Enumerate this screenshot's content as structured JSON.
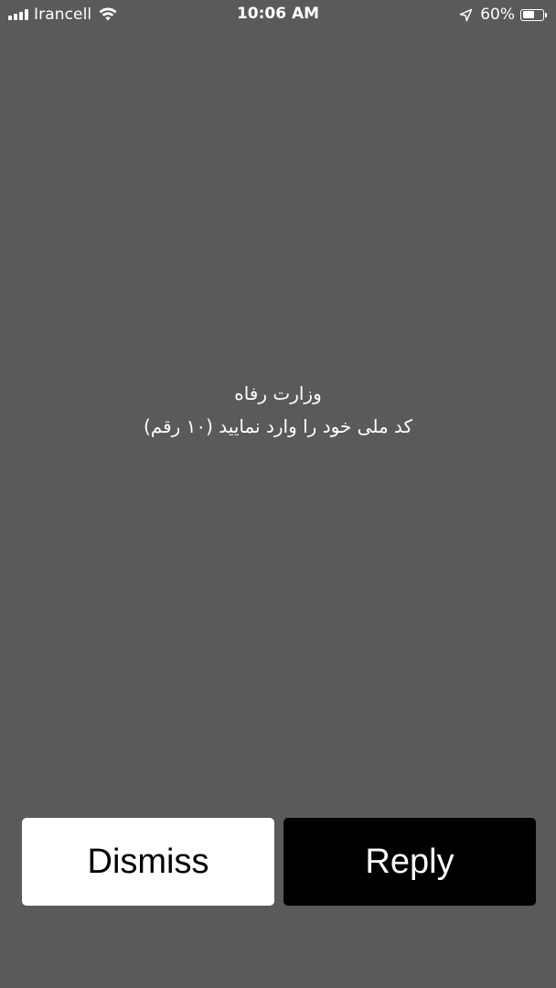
{
  "status_bar": {
    "carrier": "Irancell",
    "time": "10:06 AM",
    "battery_percent": "60%",
    "battery_level": 0.6,
    "signal_icon": "cellular-signal-icon",
    "wifi_icon": "wifi-icon",
    "location_icon": "location-arrow-icon",
    "battery_icon": "battery-icon"
  },
  "message": {
    "title": "وزارت رفاه",
    "body": "کد ملی خود را وارد نمایید (۱۰ رقم)"
  },
  "actions": {
    "dismiss_label": "Dismiss",
    "reply_label": "Reply"
  },
  "colors": {
    "background": "#5a5a5a",
    "dismiss_bg": "#ffffff",
    "reply_bg": "#000000"
  }
}
